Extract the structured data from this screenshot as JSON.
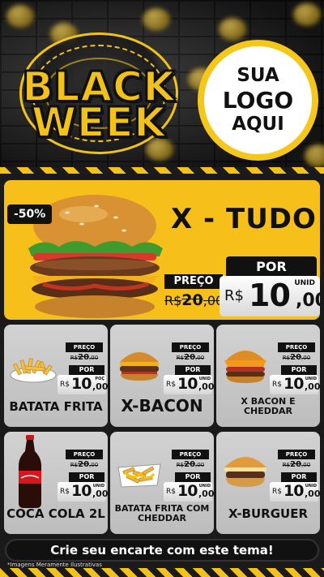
{
  "header": {
    "title_line1": "BLACK",
    "title_line2": "WEEK",
    "logo_line1": "SUA",
    "logo_line2": "LOGO",
    "logo_line3": "AQUI"
  },
  "featured": {
    "badge": "-50%",
    "name": "X - TUDO",
    "preco_label": "PREÇO",
    "old_currency": "R$",
    "old_int": "20",
    "old_cents": ",00",
    "por_label": "POR",
    "currency": "R$",
    "price_int": "10",
    "price_cents": ",00",
    "unit": "UNID"
  },
  "products": [
    {
      "name": "BATATA FRITA",
      "icon": "french-fries-icon",
      "preco_label": "PREÇO",
      "old_currency": "R$",
      "old_int": "20",
      "old_cents": ",00",
      "por_label": "POR",
      "currency": "R$",
      "price_int": "10",
      "price_cents": ",00",
      "unit": "POÇ"
    },
    {
      "name": "X-BACON",
      "icon": "burger-icon",
      "preco_label": "PREÇO",
      "old_currency": "R$",
      "old_int": "20",
      "old_cents": ",00",
      "por_label": "POR",
      "currency": "R$",
      "price_int": "10",
      "price_cents": ",00",
      "unit": "UNID"
    },
    {
      "name": "X BACON E CHEDDAR",
      "icon": "burger-icon",
      "preco_label": "PREÇO",
      "old_currency": "R$",
      "old_int": "20",
      "old_cents": ",00",
      "por_label": "POR",
      "currency": "R$",
      "price_int": "10",
      "price_cents": ",00",
      "unit": "UNID"
    },
    {
      "name": "COCA COLA 2L",
      "icon": "soda-bottle-icon",
      "preco_label": "PREÇO",
      "old_currency": "R$",
      "old_int": "20",
      "old_cents": ",00",
      "por_label": "POR",
      "currency": "R$",
      "price_int": "10",
      "price_cents": ",00",
      "unit": "UNID"
    },
    {
      "name": "BATATA FRITA COM CHEDDAR",
      "icon": "cheese-fries-icon",
      "preco_label": "PREÇO",
      "old_currency": "R$",
      "old_int": "20",
      "old_cents": ",00",
      "por_label": "POR",
      "currency": "R$",
      "price_int": "10",
      "price_cents": ",00",
      "unit": "UNID"
    },
    {
      "name": "X-BURGUER",
      "icon": "burger-icon",
      "preco_label": "PREÇO",
      "old_currency": "R$",
      "old_int": "20",
      "old_cents": ",00",
      "por_label": "POR",
      "currency": "R$",
      "price_int": "10",
      "price_cents": ",00",
      "unit": "UNID"
    }
  ],
  "footer": {
    "cta": "Crie seu encarte com este tema!",
    "disclaimer": "*Imagens Meramente Ilustrativas"
  },
  "colors": {
    "accent_yellow": "#f7bf1a",
    "dark": "#111111",
    "card_gray": "#c8c8c8"
  }
}
